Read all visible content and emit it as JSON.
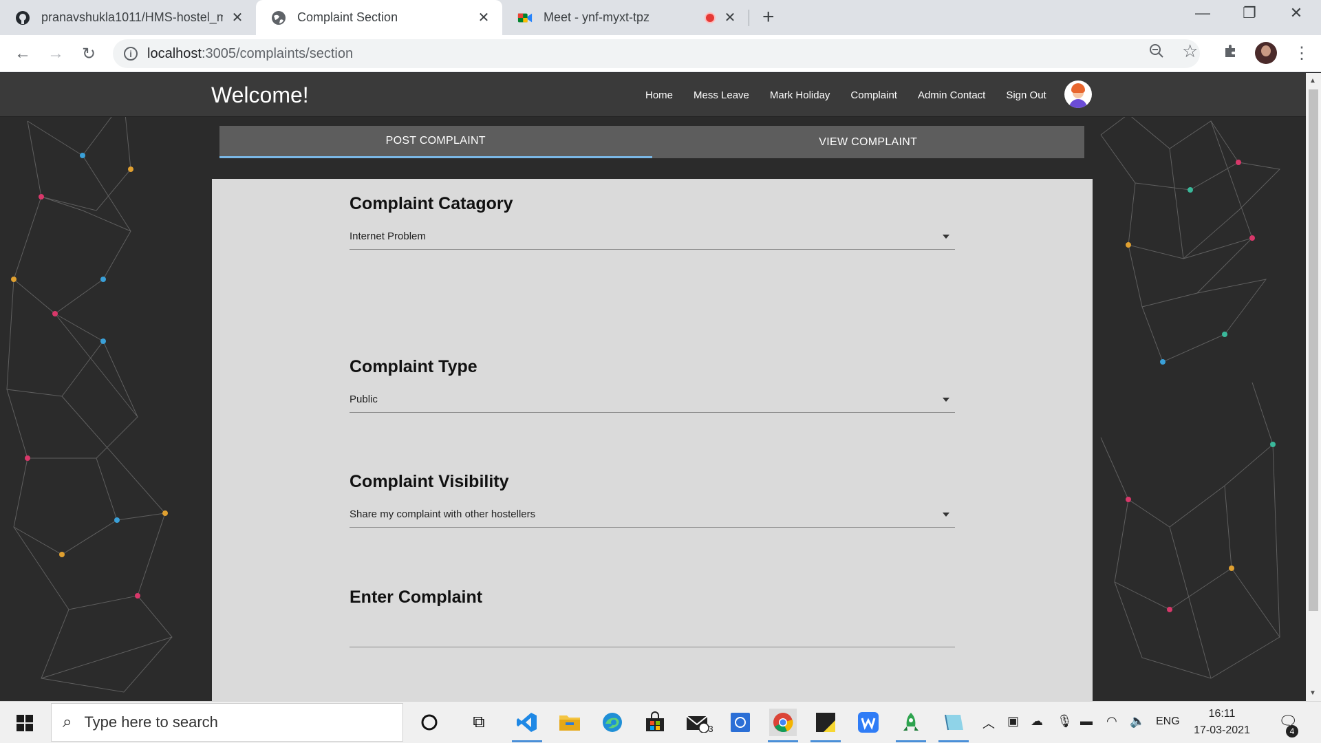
{
  "browser": {
    "tabs": [
      {
        "title": "pranavshukla1011/HMS-hostel_m",
        "icon": "github-icon"
      },
      {
        "title": "Complaint Section",
        "icon": "globe-icon"
      },
      {
        "title": "Meet - ynf-myxt-tpz",
        "icon": "google-meet-icon"
      }
    ],
    "url_host": "localhost",
    "url_path": ":3005/complaints/section"
  },
  "page": {
    "brand": "Welcome!",
    "nav": [
      "Home",
      "Mess Leave",
      "Mark Holiday",
      "Complaint",
      "Admin Contact",
      "Sign Out"
    ],
    "tabs": [
      "POST COMPLAINT",
      "VIEW COMPLAINT"
    ],
    "form": {
      "category_label": "Complaint Catagory",
      "category_value": "Internet Problem",
      "type_label": "Complaint Type",
      "type_value": "Public",
      "visibility_label": "Complaint Visibility",
      "visibility_value": "Share my complaint with other hostellers",
      "complaint_label": "Enter Complaint",
      "complaint_value": ""
    }
  },
  "taskbar": {
    "search_placeholder": "Type here to search",
    "mail_badge": "3",
    "language": "ENG",
    "time": "16:11",
    "date": "17-03-2021",
    "notification_count": "4"
  },
  "colors": {
    "navbar_bg": "#3a3a3a",
    "page_bg": "#2b2b2b",
    "card_bg": "#dadada",
    "tabsbar_bg": "#5d5d5d",
    "active_tab_underline": "#7ab8e6"
  }
}
